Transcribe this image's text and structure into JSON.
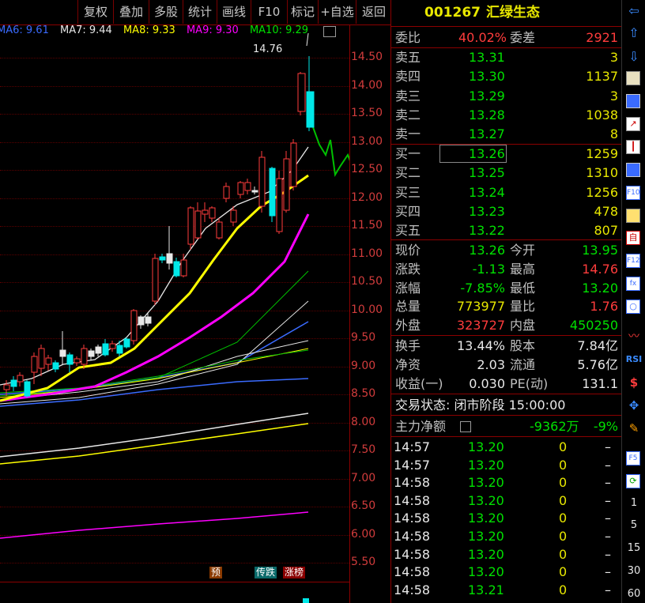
{
  "toolbar": {
    "items": [
      "复权",
      "叠加",
      "多股",
      "统计",
      "画线",
      "F10",
      "标记",
      "+自选",
      "返回"
    ]
  },
  "chart": {
    "ma_legend": [
      {
        "label": "MA6: 9.61",
        "color": "#3a6bff"
      },
      {
        "label": "MA7: 9.44",
        "color": "#e8e8e8"
      },
      {
        "label": "MA8: 9.33",
        "color": "#ffff00"
      },
      {
        "label": "MA9: 9.30",
        "color": "#ff00ff"
      },
      {
        "label": "MA10: 9.29",
        "color": "#00e000"
      }
    ],
    "peak_label": "14.76",
    "y_ticks": [
      "14.50",
      "14.00",
      "13.50",
      "13.00",
      "12.50",
      "12.00",
      "11.50",
      "11.00",
      "10.50",
      "10.00",
      "9.50",
      "9.00",
      "8.50",
      "8.00",
      "7.50",
      "7.00",
      "6.50",
      "6.00",
      "5.50"
    ],
    "badges": {
      "forecast": "预",
      "rumor": "传跌",
      "rank": "涨榜"
    }
  },
  "quote": {
    "code": "001267",
    "name": "汇绿生态",
    "weibi_label": "委比",
    "weibi_value": "40.02%",
    "weicha_label": "委差",
    "weicha_value": "2921",
    "asks": [
      {
        "label": "卖五",
        "price": "13.31",
        "vol": "3"
      },
      {
        "label": "卖四",
        "price": "13.30",
        "vol": "1137"
      },
      {
        "label": "卖三",
        "price": "13.29",
        "vol": "3"
      },
      {
        "label": "卖二",
        "price": "13.28",
        "vol": "1038"
      },
      {
        "label": "卖一",
        "price": "13.27",
        "vol": "8"
      }
    ],
    "bids": [
      {
        "label": "买一",
        "price": "13.26",
        "vol": "1259"
      },
      {
        "label": "买二",
        "price": "13.25",
        "vol": "1310"
      },
      {
        "label": "买三",
        "price": "13.24",
        "vol": "1256"
      },
      {
        "label": "买四",
        "price": "13.23",
        "vol": "478"
      },
      {
        "label": "买五",
        "price": "13.22",
        "vol": "807"
      }
    ],
    "stats": [
      {
        "l1": "现价",
        "v1": "13.26",
        "c1": "green",
        "l2": "今开",
        "v2": "13.95",
        "c2": "green"
      },
      {
        "l1": "涨跌",
        "v1": "-1.13",
        "c1": "green",
        "l2": "最高",
        "v2": "14.76",
        "c2": "red"
      },
      {
        "l1": "涨幅",
        "v1": "-7.85%",
        "c1": "green",
        "l2": "最低",
        "v2": "13.20",
        "c2": "green"
      },
      {
        "l1": "总量",
        "v1": "773977",
        "c1": "yellow",
        "l2": "量比",
        "v2": "1.76",
        "c2": "red"
      },
      {
        "l1": "外盘",
        "v1": "323727",
        "c1": "red",
        "l2": "内盘",
        "v2": "450250",
        "c2": "green"
      }
    ],
    "stats2": [
      {
        "l1": "换手",
        "v1": "13.44%",
        "l2": "股本",
        "v2": "7.84亿"
      },
      {
        "l1": "净资",
        "v1": "2.03",
        "l2": "流通",
        "v2": "5.76亿"
      },
      {
        "l1": "收益(一)",
        "v1": "0.030",
        "l2": "PE(动)",
        "v2": "131.1"
      }
    ],
    "trade_status": "交易状态: 闭市阶段 15:00:00",
    "main_flow_label": "主力净额",
    "main_flow_value": "-9362万",
    "main_flow_pct": "-9%",
    "ticks": [
      {
        "time": "14:57",
        "price": "13.20",
        "vol": "0",
        "dir": "–"
      },
      {
        "time": "14:57",
        "price": "13.20",
        "vol": "0",
        "dir": "–"
      },
      {
        "time": "14:58",
        "price": "13.20",
        "vol": "0",
        "dir": "–"
      },
      {
        "time": "14:58",
        "price": "13.20",
        "vol": "0",
        "dir": "–"
      },
      {
        "time": "14:58",
        "price": "13.20",
        "vol": "0",
        "dir": "–"
      },
      {
        "time": "14:58",
        "price": "13.20",
        "vol": "0",
        "dir": "–"
      },
      {
        "time": "14:58",
        "price": "13.20",
        "vol": "0",
        "dir": "–"
      },
      {
        "time": "14:58",
        "price": "13.20",
        "vol": "0",
        "dir": "–"
      },
      {
        "time": "14:58",
        "price": "13.21",
        "vol": "0",
        "dir": "–"
      }
    ]
  },
  "right_bar": {
    "icons": [
      "arrow-left-icon",
      "arrow-up-icon",
      "arrow-down-icon",
      "notes-icon",
      "grid-icon",
      "line-chart-icon",
      "candlestick-icon",
      "list-icon",
      "f10-icon",
      "pin-icon",
      "self-icon",
      "f12-icon",
      "formula-icon",
      "circle-icon",
      "wave-icon",
      "rsi-icon",
      "dollar-icon",
      "move-icon",
      "pencil-icon",
      "f5-icon",
      "refresh-icon"
    ],
    "rsi_label": "RSI",
    "periods": [
      "1",
      "5",
      "15",
      "30",
      "60"
    ]
  }
}
